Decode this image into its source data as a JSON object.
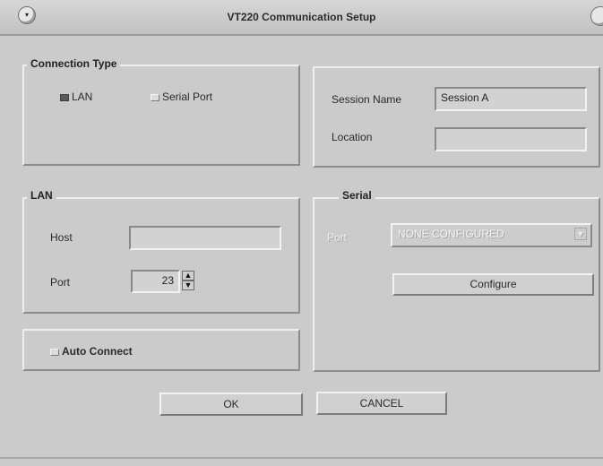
{
  "window": {
    "title": "VT220 Communication Setup",
    "menu_icon": "▾",
    "accent": "#cbcbcb"
  },
  "connection_type": {
    "title": "Connection Type",
    "lan_label": "LAN",
    "serial_label": "Serial Port",
    "selected": "LAN"
  },
  "session": {
    "name_label": "Session Name",
    "name_value": "Session A",
    "location_label": "Location",
    "location_value": ""
  },
  "lan": {
    "title": "LAN",
    "host_label": "Host",
    "host_value": "",
    "port_label": "Port",
    "port_value": "23"
  },
  "serial": {
    "title": "Serial",
    "port_label": "Port",
    "port_value": "NONE CONFIGURED",
    "configure_label": "Configure"
  },
  "auto_connect": {
    "label": "Auto Connect",
    "checked": false
  },
  "buttons": {
    "ok_label": "OK",
    "cancel_label": "CANCEL"
  }
}
